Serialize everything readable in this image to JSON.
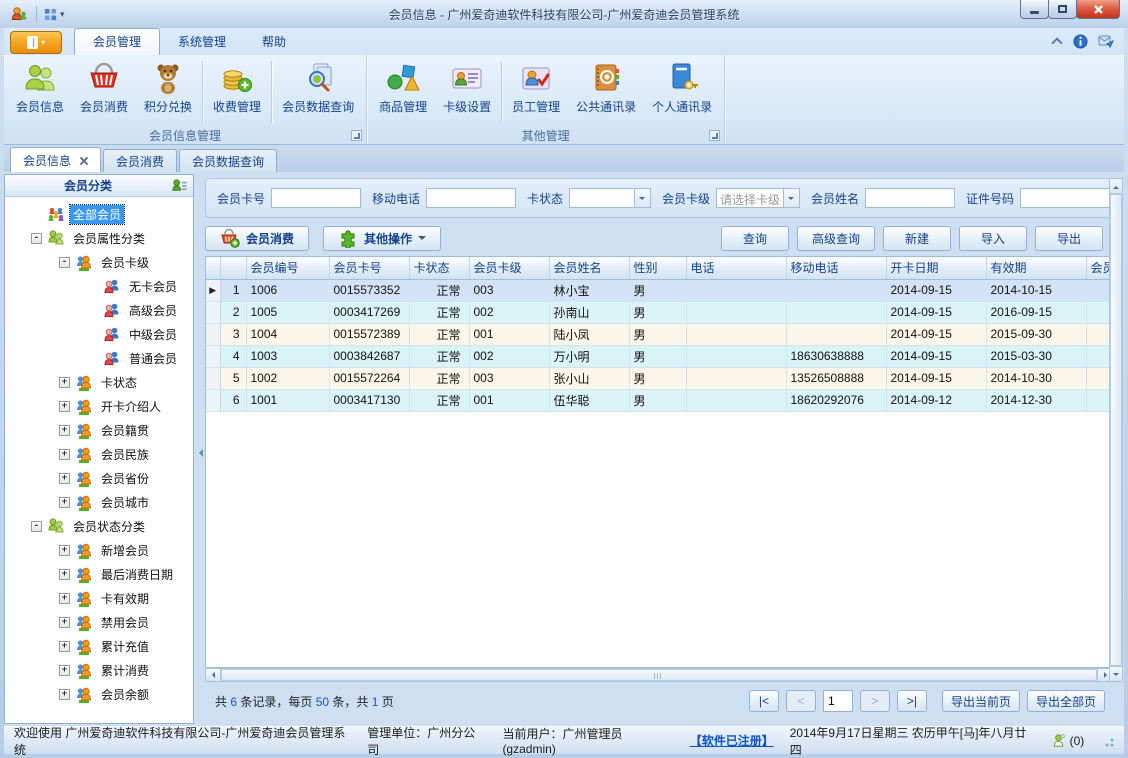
{
  "window": {
    "title": "会员信息 - 广州爱奇迪软件科技有限公司-广州爱奇迪会员管理系统"
  },
  "ribbon": {
    "tabs": [
      {
        "name": "member-management",
        "label": "会员管理",
        "active": true
      },
      {
        "name": "system-management",
        "label": "系统管理",
        "active": false
      },
      {
        "name": "help",
        "label": "帮助",
        "active": false
      }
    ],
    "groups": [
      {
        "label": "会员信息管理",
        "buttons": [
          {
            "name": "member-info",
            "label": "会员信息",
            "icon": "people-green"
          },
          {
            "name": "member-consume",
            "label": "会员消费",
            "icon": "basket-red"
          },
          {
            "name": "points-exchange",
            "label": "积分兑换",
            "icon": "teddy-bear"
          },
          {
            "divider": true
          },
          {
            "name": "fee-management",
            "label": "收费管理",
            "icon": "coins-gold"
          },
          {
            "divider": true
          },
          {
            "name": "member-data-query",
            "label": "会员数据查询",
            "icon": "doc-search"
          }
        ]
      },
      {
        "label": "其他管理",
        "buttons": [
          {
            "name": "product-management",
            "label": "商品管理",
            "icon": "shapes"
          },
          {
            "name": "card-level-settings",
            "label": "卡级设置",
            "icon": "card-level"
          },
          {
            "divider": true
          },
          {
            "name": "staff-management",
            "label": "员工管理",
            "icon": "staff"
          },
          {
            "name": "public-contacts",
            "label": "公共通讯录",
            "icon": "book-at"
          },
          {
            "name": "personal-contacts",
            "label": "个人通讯录",
            "icon": "book-key"
          }
        ]
      }
    ]
  },
  "doc_tabs": [
    {
      "name": "member-info",
      "label": "会员信息",
      "active": true,
      "closable": true
    },
    {
      "name": "member-consume",
      "label": "会员消费",
      "active": false
    },
    {
      "name": "member-data-query",
      "label": "会员数据查询",
      "active": false
    }
  ],
  "sidebar": {
    "header": "会员分类",
    "tree": [
      {
        "name": "all-members",
        "label": "全部会员",
        "level": 0,
        "expander": "none",
        "icon": "group-colorful",
        "selected": true
      },
      {
        "name": "member-attribute-category",
        "label": "会员属性分类",
        "level": 0,
        "expander": "minus",
        "icon": "duo-green"
      },
      {
        "name": "member-card-level",
        "label": "会员卡级",
        "level": 1,
        "expander": "minus",
        "icon": "duo-orange"
      },
      {
        "name": "no-card-member",
        "label": "无卡会员",
        "level": 2,
        "expander": "none",
        "icon": "duo-rb"
      },
      {
        "name": "senior-member",
        "label": "高级会员",
        "level": 2,
        "expander": "none",
        "icon": "duo-rb"
      },
      {
        "name": "middle-member",
        "label": "中级会员",
        "level": 2,
        "expander": "none",
        "icon": "duo-rb"
      },
      {
        "name": "regular-member",
        "label": "普通会员",
        "level": 2,
        "expander": "none",
        "icon": "duo-rb"
      },
      {
        "name": "card-status",
        "label": "卡状态",
        "level": 1,
        "expander": "plus",
        "icon": "duo-orange"
      },
      {
        "name": "card-introducer",
        "label": "开卡介绍人",
        "level": 1,
        "expander": "plus",
        "icon": "duo-orange"
      },
      {
        "name": "member-birthplace",
        "label": "会员籍贯",
        "level": 1,
        "expander": "plus",
        "icon": "duo-orange"
      },
      {
        "name": "member-ethnicity",
        "label": "会员民族",
        "level": 1,
        "expander": "plus",
        "icon": "duo-orange"
      },
      {
        "name": "member-province",
        "label": "会员省份",
        "level": 1,
        "expander": "plus",
        "icon": "duo-orange"
      },
      {
        "name": "member-city",
        "label": "会员城市",
        "level": 1,
        "expander": "plus",
        "icon": "duo-orange"
      },
      {
        "name": "member-status-category",
        "label": "会员状态分类",
        "level": 0,
        "expander": "minus",
        "icon": "duo-green"
      },
      {
        "name": "new-members",
        "label": "新增会员",
        "level": 1,
        "expander": "plus",
        "icon": "duo-orange"
      },
      {
        "name": "last-consume-date",
        "label": "最后消费日期",
        "level": 1,
        "expander": "plus",
        "icon": "duo-orange"
      },
      {
        "name": "card-validity",
        "label": "卡有效期",
        "level": 1,
        "expander": "plus",
        "icon": "duo-orange"
      },
      {
        "name": "disabled-members",
        "label": "禁用会员",
        "level": 1,
        "expander": "plus",
        "icon": "duo-orange"
      },
      {
        "name": "total-recharge",
        "label": "累计充值",
        "level": 1,
        "expander": "plus",
        "icon": "duo-orange"
      },
      {
        "name": "total-consume",
        "label": "累计消费",
        "level": 1,
        "expander": "plus",
        "icon": "duo-orange"
      },
      {
        "name": "member-balance",
        "label": "会员余额",
        "level": 1,
        "expander": "plus",
        "icon": "duo-orange"
      }
    ]
  },
  "filters": [
    {
      "name": "member-card-no",
      "label": "会员卡号",
      "type": "input",
      "value": ""
    },
    {
      "name": "mobile-phone",
      "label": "移动电话",
      "type": "input",
      "value": ""
    },
    {
      "name": "card-status",
      "label": "卡状态",
      "type": "select",
      "value": "",
      "placeholder": false
    },
    {
      "name": "member-card-level",
      "label": "会员卡级",
      "type": "select",
      "value": "请选择卡级",
      "placeholder": true
    },
    {
      "name": "member-name",
      "label": "会员姓名",
      "type": "input",
      "value": ""
    },
    {
      "name": "id-number",
      "label": "证件号码",
      "type": "input",
      "value": ""
    }
  ],
  "actions": {
    "left": [
      {
        "name": "member-consume",
        "label": "会员消费",
        "icon": "basket-plus",
        "dropdown": false
      },
      {
        "name": "other-operations",
        "label": "其他操作",
        "icon": "puzzle-green",
        "dropdown": true
      }
    ],
    "right": [
      {
        "name": "search",
        "label": "查询"
      },
      {
        "name": "advanced-search",
        "label": "高级查询"
      },
      {
        "name": "new",
        "label": "新建"
      },
      {
        "name": "import",
        "label": "导入"
      },
      {
        "name": "export",
        "label": "导出"
      }
    ]
  },
  "grid": {
    "columns": [
      {
        "name": "member-id",
        "label": "会员编号"
      },
      {
        "name": "card-no",
        "label": "会员卡号"
      },
      {
        "name": "card-status",
        "label": "卡状态"
      },
      {
        "name": "card-level",
        "label": "会员卡级"
      },
      {
        "name": "member-name",
        "label": "会员姓名"
      },
      {
        "name": "gender",
        "label": "性别"
      },
      {
        "name": "phone",
        "label": "电话"
      },
      {
        "name": "mobile",
        "label": "移动电话"
      },
      {
        "name": "open-date",
        "label": "开卡日期"
      },
      {
        "name": "valid-until",
        "label": "有效期"
      },
      {
        "name": "extra",
        "label": "会员"
      }
    ],
    "rows": [
      {
        "num": "1",
        "current": true,
        "cells": [
          "1006",
          "0015573352",
          "正常",
          "003",
          "林小宝",
          "男",
          "",
          "",
          "2014-09-15",
          "2014-10-15",
          ""
        ]
      },
      {
        "num": "2",
        "current": false,
        "cells": [
          "1005",
          "0003417269",
          "正常",
          "002",
          "孙南山",
          "男",
          "",
          "",
          "2014-09-15",
          "2016-09-15",
          ""
        ]
      },
      {
        "num": "3",
        "current": false,
        "cells": [
          "1004",
          "0015572389",
          "正常",
          "001",
          "陆小凤",
          "男",
          "",
          "",
          "2014-09-15",
          "2015-09-30",
          ""
        ]
      },
      {
        "num": "4",
        "current": false,
        "cells": [
          "1003",
          "0003842687",
          "正常",
          "002",
          "万小明",
          "男",
          "",
          "18630638888",
          "2014-09-15",
          "2015-03-30",
          ""
        ]
      },
      {
        "num": "5",
        "current": false,
        "cells": [
          "1002",
          "0015572264",
          "正常",
          "003",
          "张小山",
          "男",
          "",
          "13526508888",
          "2014-09-15",
          "2014-10-30",
          ""
        ]
      },
      {
        "num": "6",
        "current": false,
        "cells": [
          "1001",
          "0003417130",
          "正常",
          "001",
          "伍华聪",
          "男",
          "",
          "18620292076",
          "2014-09-12",
          "2014-12-30",
          ""
        ]
      }
    ]
  },
  "pager": {
    "summary": [
      {
        "t": "共 ",
        "accent": false
      },
      {
        "t": "6",
        "accent": true
      },
      {
        "t": " 条记录，每页 ",
        "accent": false
      },
      {
        "t": "50",
        "accent": true
      },
      {
        "t": " 条，共 ",
        "accent": false
      },
      {
        "t": "1",
        "accent": true
      },
      {
        "t": " 页",
        "accent": false
      }
    ],
    "first": "|<",
    "prev": "<",
    "page": "1",
    "next": ">",
    "last": ">|",
    "export_current": "导出当前页",
    "export_all": "导出全部页"
  },
  "statusbar": {
    "welcome": "欢迎使用 广州爱奇迪软件科技有限公司-广州爱奇迪会员管理系统",
    "org": "管理单位：广州分公司",
    "user": "当前用户：广州管理员(gzadmin)",
    "registered": "【软件已注册】",
    "date": "2014年9月17日星期三 农历甲午[马]年八月廿四",
    "messages": "(0)"
  }
}
